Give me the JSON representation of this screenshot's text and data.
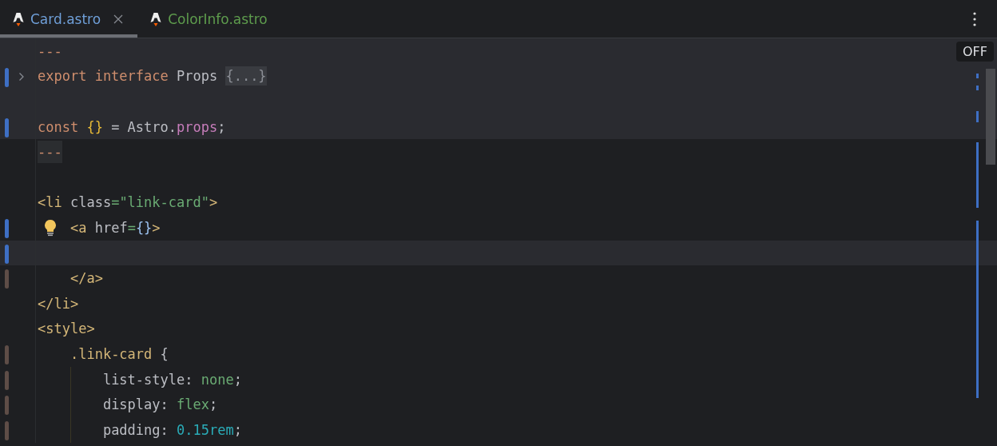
{
  "tabs": [
    {
      "label": "Card.astro",
      "selected": true,
      "color": "#6f9fd8"
    },
    {
      "label": "ColorInfo.astro",
      "selected": false,
      "color": "#5e9c4d"
    }
  ],
  "inspection_badge": "OFF",
  "lines": [
    {
      "region": true,
      "tokens": [
        {
          "text": "---",
          "kind": "fence"
        }
      ]
    },
    {
      "color": "#3e6fc4",
      "region": true,
      "folded": true,
      "tokens": [
        {
          "text": "export interface",
          "kind": "keyword"
        },
        {
          "text": " Props ",
          "kind": "plain"
        },
        {
          "text": "{...}",
          "kind": "fold"
        }
      ]
    },
    {
      "region": true
    },
    {
      "color": "#3e6fc4",
      "region": true,
      "tokens": [
        {
          "text": "const ",
          "kind": "keyword"
        },
        {
          "text": "{}",
          "kind": "brace"
        },
        {
          "text": " = Astro.",
          "kind": "plain"
        },
        {
          "text": "props",
          "kind": "property"
        },
        {
          "text": ";",
          "kind": "plain"
        }
      ]
    },
    {
      "region": false,
      "tokens": [
        {
          "text": "---",
          "kind": "fence"
        }
      ]
    },
    {
      "region": false
    },
    {
      "region": false,
      "tokens": [
        {
          "text": "<li",
          "kind": "tag"
        },
        {
          "text": " class",
          "kind": "plain"
        },
        {
          "text": "=\"link-card\"",
          "kind": "string"
        },
        {
          "text": ">",
          "kind": "tag"
        }
      ]
    },
    {
      "color": "#3e6fc4",
      "region": false,
      "bulb": true,
      "tokens": [
        {
          "text": "    <a",
          "kind": "tag"
        },
        {
          "text": " href",
          "kind": "plain"
        },
        {
          "text": "=",
          "kind": "string"
        },
        {
          "text": "{}",
          "kind": "attr-brace"
        },
        {
          "text": ">",
          "kind": "tag"
        }
      ]
    },
    {
      "color": "#3e6fc4",
      "region": false,
      "current": true
    },
    {
      "color": "#5e4d47",
      "region": false,
      "tokens": [
        {
          "text": "    </a>",
          "kind": "tag"
        }
      ]
    },
    {
      "region": false,
      "tokens": [
        {
          "text": "</li>",
          "kind": "tag"
        }
      ]
    },
    {
      "region": false,
      "tokens": [
        {
          "text": "<style>",
          "kind": "tag"
        }
      ]
    },
    {
      "color": "#5e4d47",
      "region": false,
      "tokens": [
        {
          "text": "    .link-card",
          "kind": "selector"
        },
        {
          "text": " {",
          "kind": "plain"
        }
      ]
    },
    {
      "color": "#5e4d47",
      "region": false,
      "guide": true,
      "tokens": [
        {
          "text": "        list-style: ",
          "kind": "plain"
        },
        {
          "text": "none",
          "kind": "value"
        },
        {
          "text": ";",
          "kind": "plain"
        }
      ]
    },
    {
      "color": "#5e4d47",
      "region": false,
      "guide": true,
      "tokens": [
        {
          "text": "        display: ",
          "kind": "plain"
        },
        {
          "text": "flex",
          "kind": "value"
        },
        {
          "text": ";",
          "kind": "plain"
        }
      ]
    },
    {
      "color": "#5e4d47",
      "region": false,
      "guide": true,
      "tokens": [
        {
          "text": "        padding: ",
          "kind": "plain"
        },
        {
          "text": "0.15rem",
          "kind": "number"
        },
        {
          "text": ";",
          "kind": "plain"
        }
      ]
    }
  ]
}
